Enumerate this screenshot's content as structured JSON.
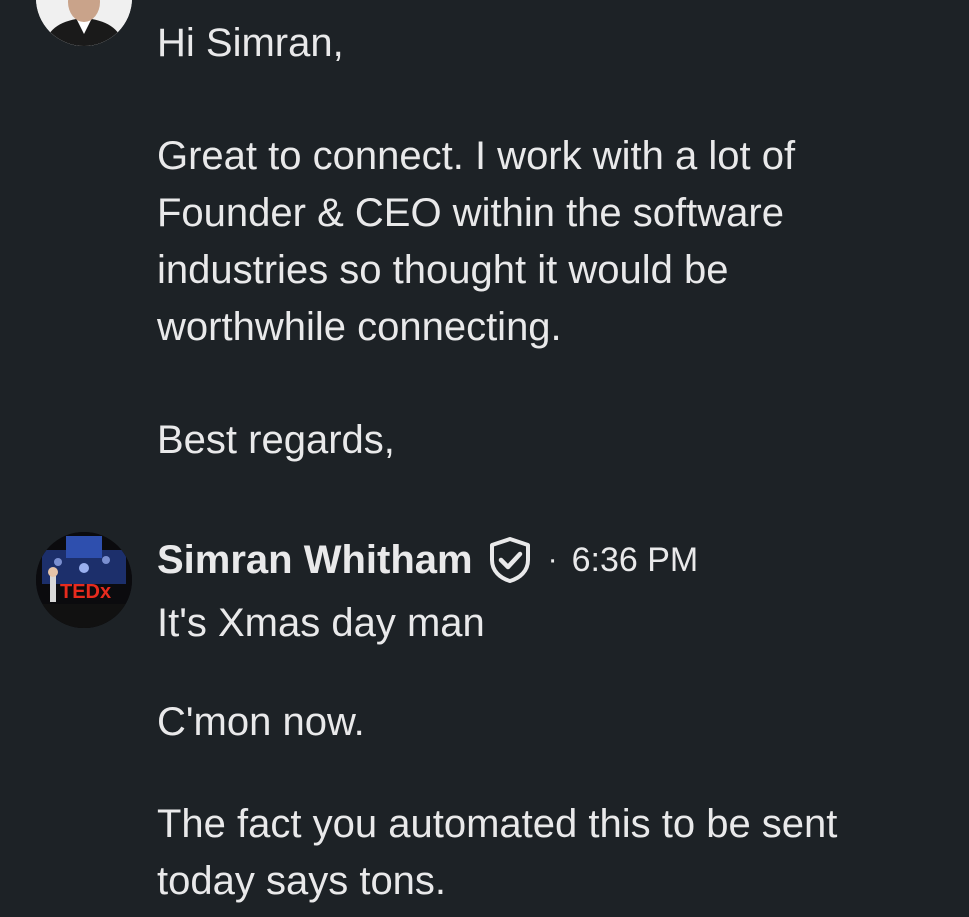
{
  "messages": [
    {
      "sender_avatar_icon": "profile-photo-icon",
      "lines": [
        "Hi Simran,",
        "Great to connect. I work with a lot of",
        "Founder & CEO within the software",
        "industries so thought it would be",
        "worthwhile connecting.",
        "Best regards,"
      ]
    },
    {
      "sender_name": "Simran Whitham",
      "verified_icon": "shield-check-icon",
      "separator": "·",
      "timestamp": "6:36 PM",
      "sender_avatar_icon": "tedx-profile-photo-icon",
      "avatar_logo_text": "TEDx",
      "lines": [
        "It's Xmas day man",
        "C'mon now.",
        "The fact you automated this to be sent",
        "today says tons."
      ]
    }
  ],
  "colors": {
    "background": "#1d2226",
    "text": "#e9e9ea",
    "tedx_red": "#e62b1e"
  }
}
